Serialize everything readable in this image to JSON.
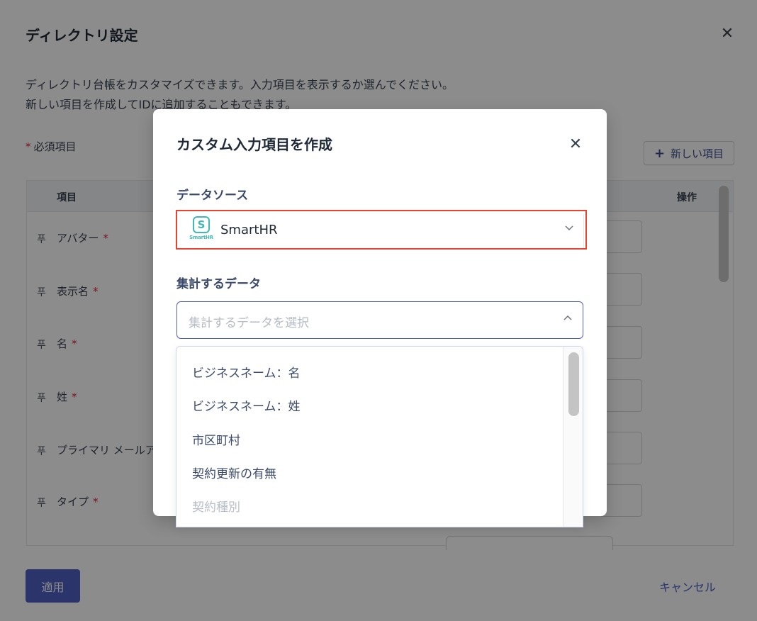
{
  "background_dialog": {
    "title": "ディレクトリ設定",
    "close_icon": "close-icon",
    "description_line1": "ディレクトリ台帳をカスタマイズできます。入力項目を表示するか選んでください。",
    "description_line2": "新しい項目を作成してIDに追加することもできます。",
    "required_marker": "*",
    "required_label": "必須項目",
    "new_item_button": {
      "icon": "+",
      "label": "新しい項目"
    },
    "table": {
      "header_item": "項目",
      "header_operation": "操作",
      "rows": [
        {
          "pin": "푸",
          "label": "アバター",
          "required": "*"
        },
        {
          "pin": "푸",
          "label": "表示名",
          "required": "*"
        },
        {
          "pin": "푸",
          "label": "名",
          "required": "*"
        },
        {
          "pin": "푸",
          "label": "姓",
          "required": "*"
        },
        {
          "pin": "푸",
          "label": "プライマリ メールア",
          "required": ""
        },
        {
          "pin": "푸",
          "label": "タイプ",
          "required": "*"
        }
      ]
    },
    "apply_button": "適用",
    "cancel_link": "キャンセル"
  },
  "modal": {
    "title": "カスタム入力項目を作成",
    "close_icon": "close-icon",
    "data_source": {
      "label": "データソース",
      "logo_letter": "S",
      "logo_text": "SmartHR",
      "value": "SmartHR",
      "chevron": "chevron-down-icon"
    },
    "aggregate": {
      "label": "集計するデータ",
      "placeholder": "集計するデータを選択",
      "chevron": "chevron-up-icon"
    },
    "dropdown_options": [
      "ビジネスネーム：名",
      "ビジネスネーム：姓",
      "市区町村",
      "契約更新の有無",
      "契約種別"
    ]
  },
  "colors": {
    "primary": "#4f5fc4",
    "highlight_border": "#e8432e",
    "smarthr_teal": "#3fb8b6",
    "required_star": "#e11d48"
  }
}
